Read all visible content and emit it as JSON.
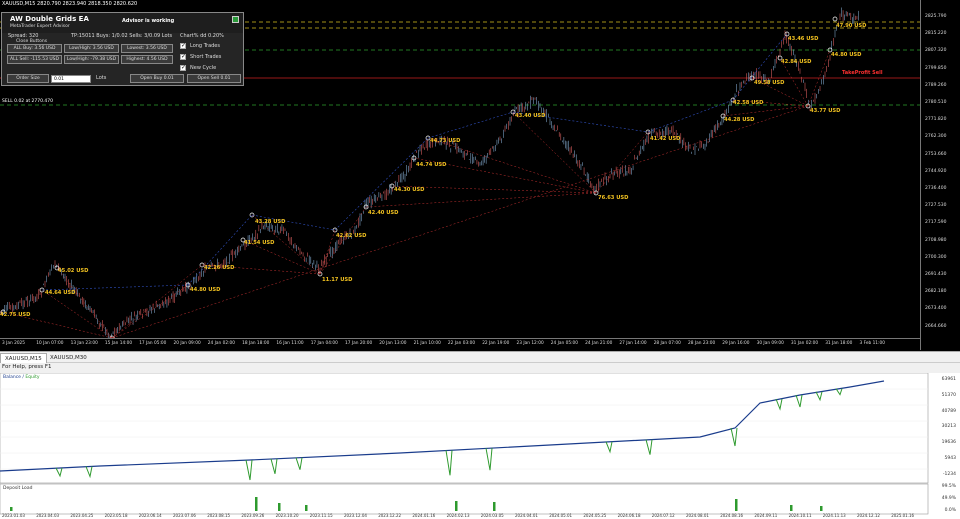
{
  "chart_title": "XAUUSD,M15  2820.790 2823.940 2818.350 2820.620",
  "ea": {
    "title": "AW Double Grids EA",
    "subtitle": "MetaTrader Expert Advisor",
    "status": "Advisor is working",
    "spread": "Spread: 320",
    "tp_info": "TP:15011 Buys: 1/0.02 Sells: 3/0.09 Lots",
    "chart_dd": "Chart% dd 0.20%",
    "close_buttons_label": "Close Buttons",
    "btn_all_buy": "ALL Buy: 3.56 USD",
    "btn_low_high_buy": "Low/High: 3.56 USD",
    "btn_lowest": "Lowest: 3.56 USD",
    "btn_all_sell": "ALL Sell: -115.53 USD",
    "btn_low_high_sell": "Low/High: -79.38 USD",
    "btn_highest": "Highest: 4.56 USD",
    "chk_long": "Long Trades",
    "chk_short": "Short Trades",
    "chk_new_cycle": "New Cycle",
    "order_size_label": "Order Size",
    "order_size_value": "0.01",
    "lots_label": "Lots",
    "btn_open_buy": "Open Buy 0.01",
    "btn_open_sell": "Open Sell 0.01"
  },
  "sell_label": "SELL 0.02 at 2770.470",
  "tp_sell_label": "TakeProfit Sell",
  "price_labels": [
    "2825.790",
    "2815.220",
    "2807.320",
    "2799.850",
    "2789.260",
    "2780.510",
    "2771.820",
    "2762.300",
    "2753.660",
    "2744.920",
    "2736.400",
    "2727.530",
    "2717.590",
    "2708.980",
    "2700.300",
    "2691.430",
    "2682.180",
    "2673.400",
    "2664.660"
  ],
  "time_labels": [
    "3 Jan 2025",
    "10 Jan 07:00",
    "13 Jan 23:00",
    "15 Jan 14:00",
    "17 Jan 05:00",
    "20 Jan 09:00",
    "24 Jan 02:00",
    "18 Jan 18:00",
    "16 Jan 11:00",
    "17 Jan 04:00",
    "17 Jan 20:00",
    "20 Jan 13:00",
    "21 Jan 10:00",
    "22 Jan 03:00",
    "22 Jan 19:00",
    "23 Jan 12:00",
    "24 Jan 05:00",
    "24 Jan 21:00",
    "27 Jan 14:00",
    "28 Jan 07:00",
    "28 Jan 23:00",
    "29 Jan 16:00",
    "30 Jan 09:00",
    "31 Jan 02:00",
    "31 Jan 18:00",
    "3 Feb 11:00"
  ],
  "trade_labels": [
    {
      "text": "42.75 USD"
    },
    {
      "text": "44.64 USD"
    },
    {
      "text": "45.02 USD"
    },
    {
      "text": "42.81 USD"
    },
    {
      "text": "44.80 USD"
    },
    {
      "text": "42.26 USD"
    },
    {
      "text": "43.28 USD"
    },
    {
      "text": "41.54 USD"
    },
    {
      "text": "11.17 USD"
    },
    {
      "text": "42.62 USD"
    },
    {
      "text": "42.40 USD"
    },
    {
      "text": "44.30 USD"
    },
    {
      "text": "44.74 USD"
    },
    {
      "text": "44.73 USD"
    },
    {
      "text": "43.40 USD"
    },
    {
      "text": "76.63 USD"
    },
    {
      "text": "41.42 USD"
    },
    {
      "text": "44.28 USD"
    },
    {
      "text": "42.58 USD"
    },
    {
      "text": "49.58 USD"
    },
    {
      "text": "43.77 USD"
    },
    {
      "text": "42.84 USD"
    },
    {
      "text": "44.80 USD"
    },
    {
      "text": "43.46 USD"
    },
    {
      "text": "47.90 USD"
    }
  ],
  "tabs": [
    "XAUUSD,M15",
    "XAUUSD,M30"
  ],
  "status_text": "For Help, press F1",
  "tester": {
    "legend_balance": "Balance",
    "legend_equity": "Equity",
    "axis": [
      "63961",
      "51370",
      "40789",
      "30213",
      "19636",
      "5943",
      "-1234"
    ],
    "deposit_label": "Deposit Load",
    "deposit_axis": [
      "99.5%",
      "49.9%",
      "0.0%"
    ],
    "dates": [
      "2023.01.03",
      "2023.04.03",
      "2023.04.25",
      "2023.05.18",
      "2023.06.14",
      "2023.07.06",
      "2023.08.15",
      "2023.09.26",
      "2023.10.20",
      "2023.11.15",
      "2023.12.04",
      "2023.12.22",
      "2024.01.16",
      "2024.02.13",
      "2024.03.05",
      "2024.04.01",
      "2024.05.01",
      "2024.05.25",
      "2024.06.18",
      "2024.07.12",
      "2024.08.01",
      "2024.08.16",
      "2024.09.11",
      "2024.10.11",
      "2024.11.13",
      "2024.12.12",
      "2025.01.16"
    ]
  },
  "colors": {
    "candle_up": "#7a9ec0",
    "candle_down": "#d05a5a",
    "grid_line_green": "#2ea02e",
    "grid_line_yellow": "#d8c020",
    "sell_line": "#cc2222",
    "trade_label": "#f0c020",
    "balance": "#1a3c8c",
    "equity": "#2e9a2e"
  }
}
